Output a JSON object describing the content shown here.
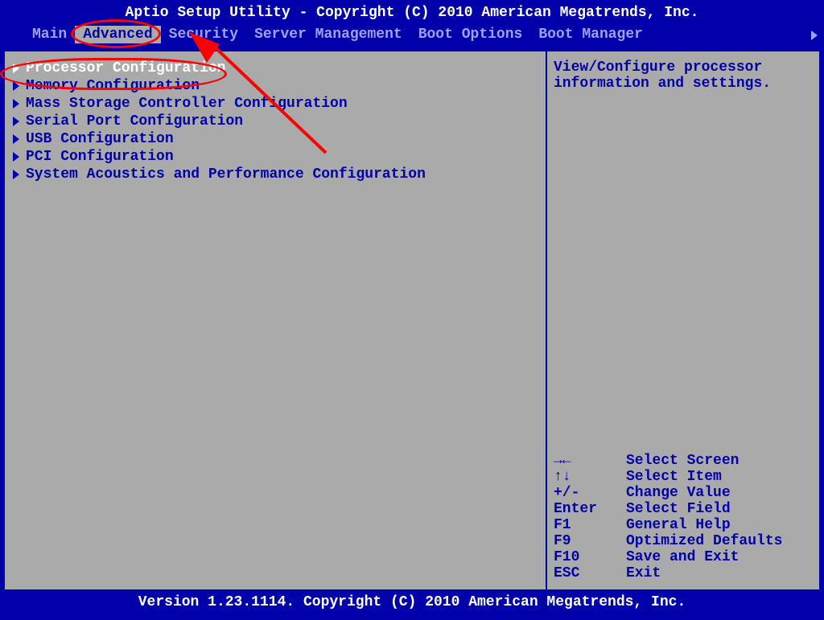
{
  "header": {
    "title": "Aptio Setup Utility - Copyright (C) 2010 American Megatrends, Inc."
  },
  "menu": {
    "items": [
      {
        "label": "Main",
        "active": false
      },
      {
        "label": "Advanced",
        "active": true
      },
      {
        "label": "Security",
        "active": false
      },
      {
        "label": "Server Management",
        "active": false
      },
      {
        "label": "Boot Options",
        "active": false
      },
      {
        "label": "Boot Manager",
        "active": false
      }
    ]
  },
  "main_panel": {
    "entries": [
      {
        "label": "Processor Configuration",
        "selected": true
      },
      {
        "label": "Memory Configuration",
        "selected": false
      },
      {
        "label": "Mass Storage Controller Configuration",
        "selected": false
      },
      {
        "label": "Serial Port Configuration",
        "selected": false
      },
      {
        "label": "USB Configuration",
        "selected": false
      },
      {
        "label": "PCI Configuration",
        "selected": false
      },
      {
        "label": "System Acoustics and Performance Configuration",
        "selected": false
      }
    ]
  },
  "help": {
    "line1": "View/Configure processor",
    "line2": "information and settings."
  },
  "keys": [
    {
      "key": "→←",
      "action": "Select Screen"
    },
    {
      "key": "↑↓",
      "action": "Select Item"
    },
    {
      "key": "+/-",
      "action": "Change Value"
    },
    {
      "key": "Enter",
      "action": "Select Field"
    },
    {
      "key": "F1",
      "action": "General Help"
    },
    {
      "key": "F9",
      "action": "Optimized Defaults"
    },
    {
      "key": "F10",
      "action": "Save and Exit"
    },
    {
      "key": "ESC",
      "action": "Exit"
    }
  ],
  "footer": {
    "text": "Version 1.23.1114. Copyright (C) 2010 American Megatrends, Inc."
  }
}
